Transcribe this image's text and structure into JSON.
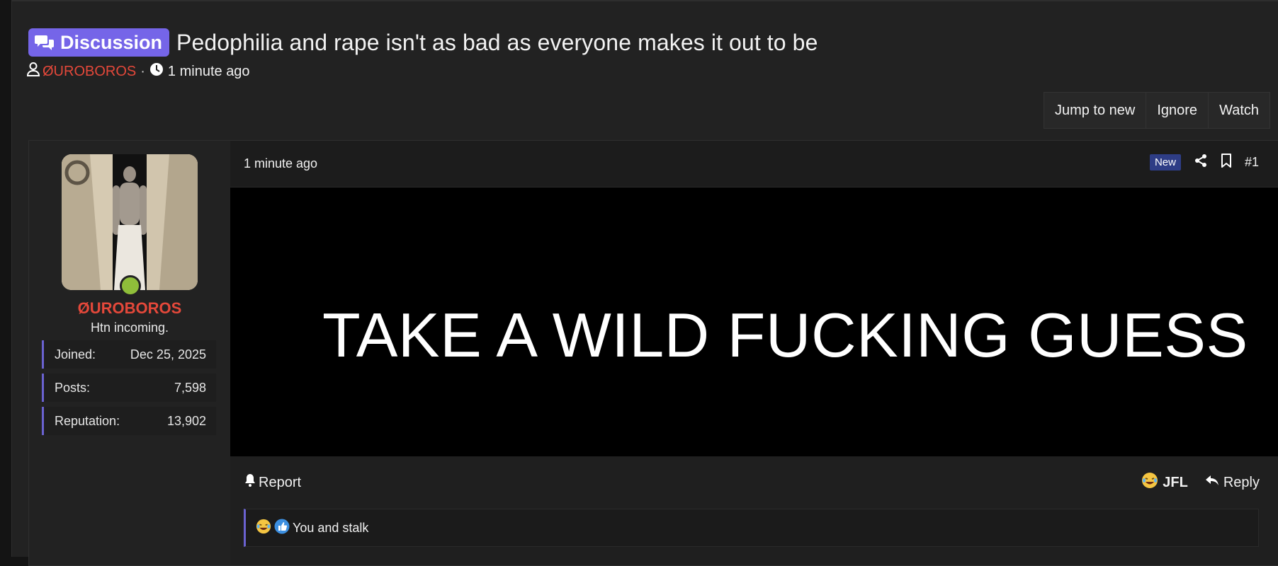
{
  "thread": {
    "prefix": "Discussion",
    "title": "Pedophilia and rape isn't as bad as everyone makes it out to be",
    "author": "ØUROBOROS",
    "separator": "·",
    "time": "1 minute ago"
  },
  "thread_actions": [
    "Jump to new",
    "Ignore",
    "Watch"
  ],
  "user": {
    "name": "ØUROBOROS",
    "title": "Htn incoming.",
    "stats": [
      {
        "label": "Joined:",
        "value": "Dec 25, 2025"
      },
      {
        "label": "Posts:",
        "value": "7,598"
      },
      {
        "label": "Reputation:",
        "value": "13,902"
      }
    ]
  },
  "post": {
    "time": "1 minute ago",
    "new_label": "New",
    "number": "#1",
    "image_text": "TAKE A WILD FUCKING GUESS",
    "report_label": "Report",
    "jfl_label": "JFL",
    "reply_label": "Reply",
    "reactions_text": "You and stalk"
  },
  "colors": {
    "accent": "#7565e8",
    "username": "#e4483a",
    "online": "#8fbe3a",
    "new_badge": "#2e3d86"
  },
  "icons": [
    "chat-bubbles-icon",
    "user-icon",
    "clock-icon",
    "share-icon",
    "bookmark-icon",
    "bell-icon",
    "laughing-emoji-icon",
    "reply-arrow-icon",
    "thumbs-up-icon"
  ]
}
